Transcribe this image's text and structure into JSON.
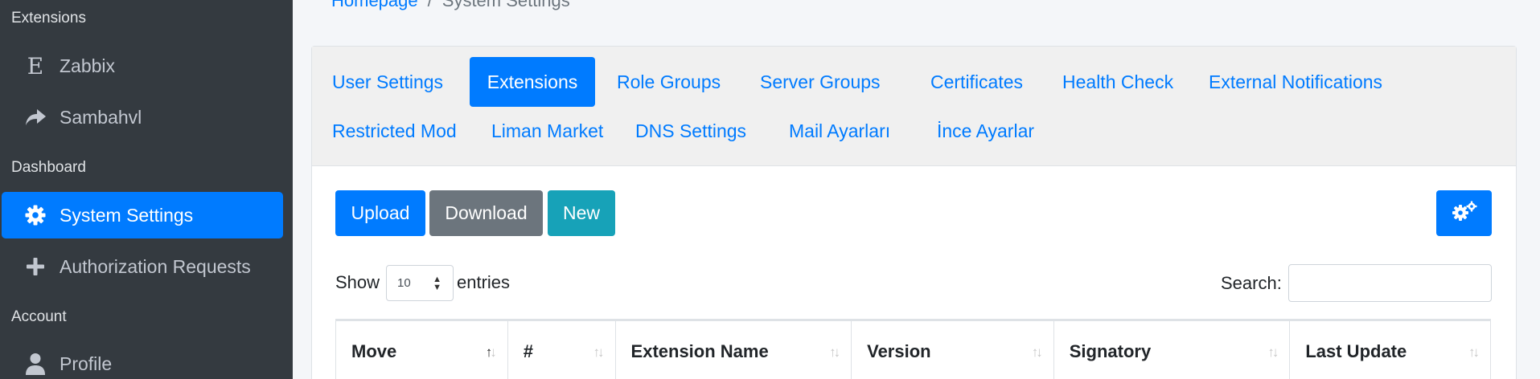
{
  "sidebar": {
    "sections": [
      "Extensions",
      "Dashboard",
      "Account"
    ],
    "items": [
      {
        "label": "Zabbix",
        "icon": "letter-e-icon"
      },
      {
        "label": "Sambahvl",
        "icon": "share-arrow-icon"
      },
      {
        "label": "System Settings",
        "icon": "gear-icon",
        "active": true
      },
      {
        "label": "Authorization Requests",
        "icon": "plus-icon"
      },
      {
        "label": "Profile",
        "icon": "user-icon"
      }
    ]
  },
  "breadcrumb": {
    "home": "Homepage",
    "separator": "/",
    "current": "System Settings"
  },
  "tabs": [
    "User Settings",
    "Extensions",
    "Role Groups",
    "Server Groups",
    "Certificates",
    "Health Check",
    "External Notifications",
    "Restricted Mod",
    "Liman Market",
    "DNS Settings",
    "Mail Ayarları",
    "İnce Ayarlar"
  ],
  "active_tab": "Extensions",
  "toolbar": {
    "upload": "Upload",
    "download": "Download",
    "new": "New",
    "settings_icon": "gears-icon"
  },
  "length": {
    "show": "Show",
    "value": "10",
    "entries": "entries"
  },
  "search": {
    "label": "Search:",
    "value": ""
  },
  "table": {
    "columns": [
      "Move",
      "#",
      "Extension Name",
      "Version",
      "Signatory",
      "Last Update"
    ]
  },
  "colors": {
    "primary": "#007bff",
    "secondary": "#6c757d",
    "info": "#17a2b8",
    "sidebar": "#343a40"
  }
}
